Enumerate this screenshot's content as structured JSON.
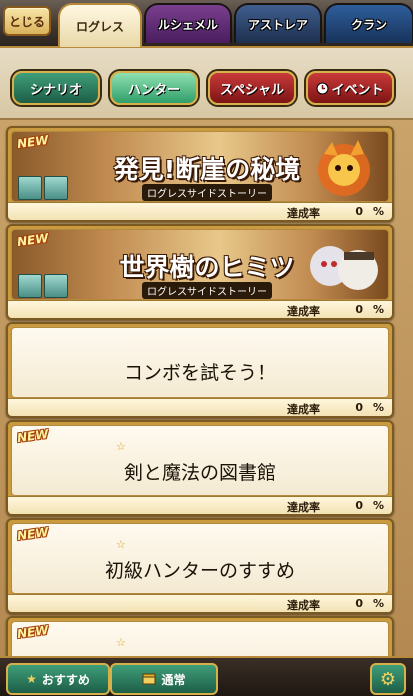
{
  "header": {
    "back_label": "とじる",
    "tabs": [
      {
        "label": "ログレス",
        "active": true
      },
      {
        "label": "ルシェメル",
        "active": false
      },
      {
        "label": "アストレア",
        "active": false
      },
      {
        "label": "クラン",
        "active": false
      }
    ]
  },
  "categories": [
    {
      "label": "シナリオ",
      "selected": false
    },
    {
      "label": "ハンター",
      "selected": true
    },
    {
      "label": "スペシャル",
      "selected": false
    },
    {
      "label": "イベント",
      "selected": false,
      "icon": "clock-icon"
    }
  ],
  "list": {
    "rate_label": "達成率",
    "rate_unit": "%",
    "new_label": "NEW",
    "items": [
      {
        "title": "発見!断崖の秘境",
        "subtitle": "ログレスサイドストーリー",
        "rate": "0",
        "is_new": true,
        "banner": true
      },
      {
        "title": "世界樹のヒミツ",
        "subtitle": "ログレスサイドストーリー",
        "rate": "0",
        "is_new": true,
        "banner": true
      },
      {
        "title": "コンボを試そう！",
        "rate": "0",
        "is_new": false,
        "banner": false
      },
      {
        "title": "剣と魔法の図書館",
        "rate": "0",
        "is_new": true,
        "banner": false,
        "star": true
      },
      {
        "title": "初級ハンターのすすめ",
        "rate": "0",
        "is_new": true,
        "banner": false,
        "star": true
      }
    ]
  },
  "footer": {
    "recommend_label": "おすすめ",
    "normal_label": "通常",
    "settings_icon": "gear-icon"
  },
  "colors": {
    "accent_gold": "#d6b04a",
    "button_green": "#1d5e46",
    "button_red": "#7e1414"
  }
}
